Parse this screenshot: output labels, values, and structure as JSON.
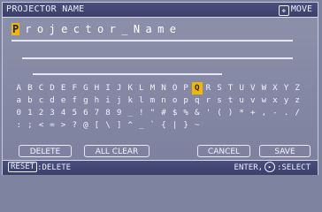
{
  "window": {
    "title": "PROJECTOR NAME",
    "move_label": "MOVE",
    "move_icon": "four-arrow-move-icon"
  },
  "name_field": {
    "cursor_char": "P",
    "value_rest": "rojector_Name"
  },
  "char_grid": {
    "rows": [
      [
        "A",
        "B",
        "C",
        "D",
        "E",
        "F",
        "G",
        "H",
        "I",
        "J",
        "K",
        "L",
        "M",
        "N",
        "O",
        "P",
        "Q",
        "R",
        "S",
        "T",
        "U",
        "V",
        "W",
        "X",
        "Y",
        "Z"
      ],
      [
        "a",
        "b",
        "c",
        "d",
        "e",
        "f",
        "g",
        "h",
        "i",
        "j",
        "k",
        "l",
        "m",
        "n",
        "o",
        "p",
        "q",
        "r",
        "s",
        "t",
        "u",
        "v",
        "w",
        "x",
        "y",
        "z"
      ],
      [
        "0",
        "1",
        "2",
        "3",
        "4",
        "5",
        "6",
        "7",
        "8",
        "9",
        "_",
        "!",
        "\"",
        "#",
        "$",
        "%",
        "&",
        "'",
        "(",
        ")",
        "*",
        "+",
        ",",
        "-",
        ".",
        "/"
      ],
      [
        ":",
        ";",
        "<",
        "=",
        ">",
        "?",
        "@",
        "[",
        "\\",
        "]",
        "^",
        "_",
        "`",
        "{",
        "|",
        "}",
        "~"
      ]
    ],
    "selected": "Q"
  },
  "buttons": {
    "delete": "DELETE",
    "all_clear": "ALL CLEAR",
    "cancel": "CANCEL",
    "save": "SAVE"
  },
  "footer": {
    "reset_key": "RESET",
    "reset_action": "DELETE",
    "enter_key": "ENTER",
    "enter_action": "SELECT"
  },
  "colors": {
    "background": "#7e83a0",
    "titlebar": "#3b3f69",
    "highlight": "#f2b800",
    "text": "#f2f3ff"
  }
}
